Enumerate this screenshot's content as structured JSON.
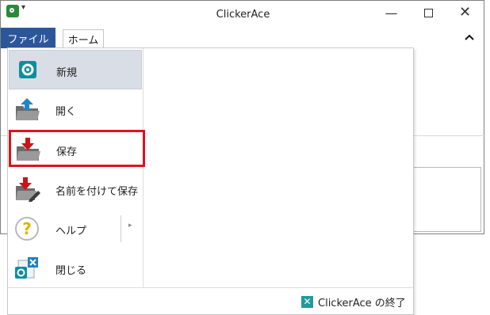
{
  "window": {
    "title": "ClickerAce",
    "qat_arrow": "▾",
    "minimize_glyph": "—",
    "close_glyph": "✕"
  },
  "ribbon": {
    "tabs": [
      {
        "label": "ファイル",
        "active": true
      },
      {
        "label": "ホーム",
        "active": false
      }
    ],
    "collapse_glyph": "⌃"
  },
  "file_menu": {
    "items": [
      {
        "label": "新規",
        "icon": "app-new-icon",
        "highlighted": true
      },
      {
        "label": "開く",
        "icon": "open-folder-icon"
      },
      {
        "label": "保存",
        "icon": "save-folder-icon",
        "outlined_red": true
      },
      {
        "label": "名前を付けて保存",
        "icon": "save-as-icon"
      },
      {
        "label": "ヘルプ",
        "icon": "help-icon",
        "has_submenu": true,
        "submenu_glyph": "▸"
      },
      {
        "label": "閉じる",
        "icon": "close-document-icon"
      }
    ],
    "exit_label": "ClickerAce の終了",
    "exit_icon_glyph": "✕"
  },
  "colors": {
    "file_tab": "#2b579a",
    "highlight_border": "#e0121f",
    "selected_item_bg": "#d9dde6",
    "app_green": "#2a8a37",
    "exit_teal": "#219a9f"
  }
}
